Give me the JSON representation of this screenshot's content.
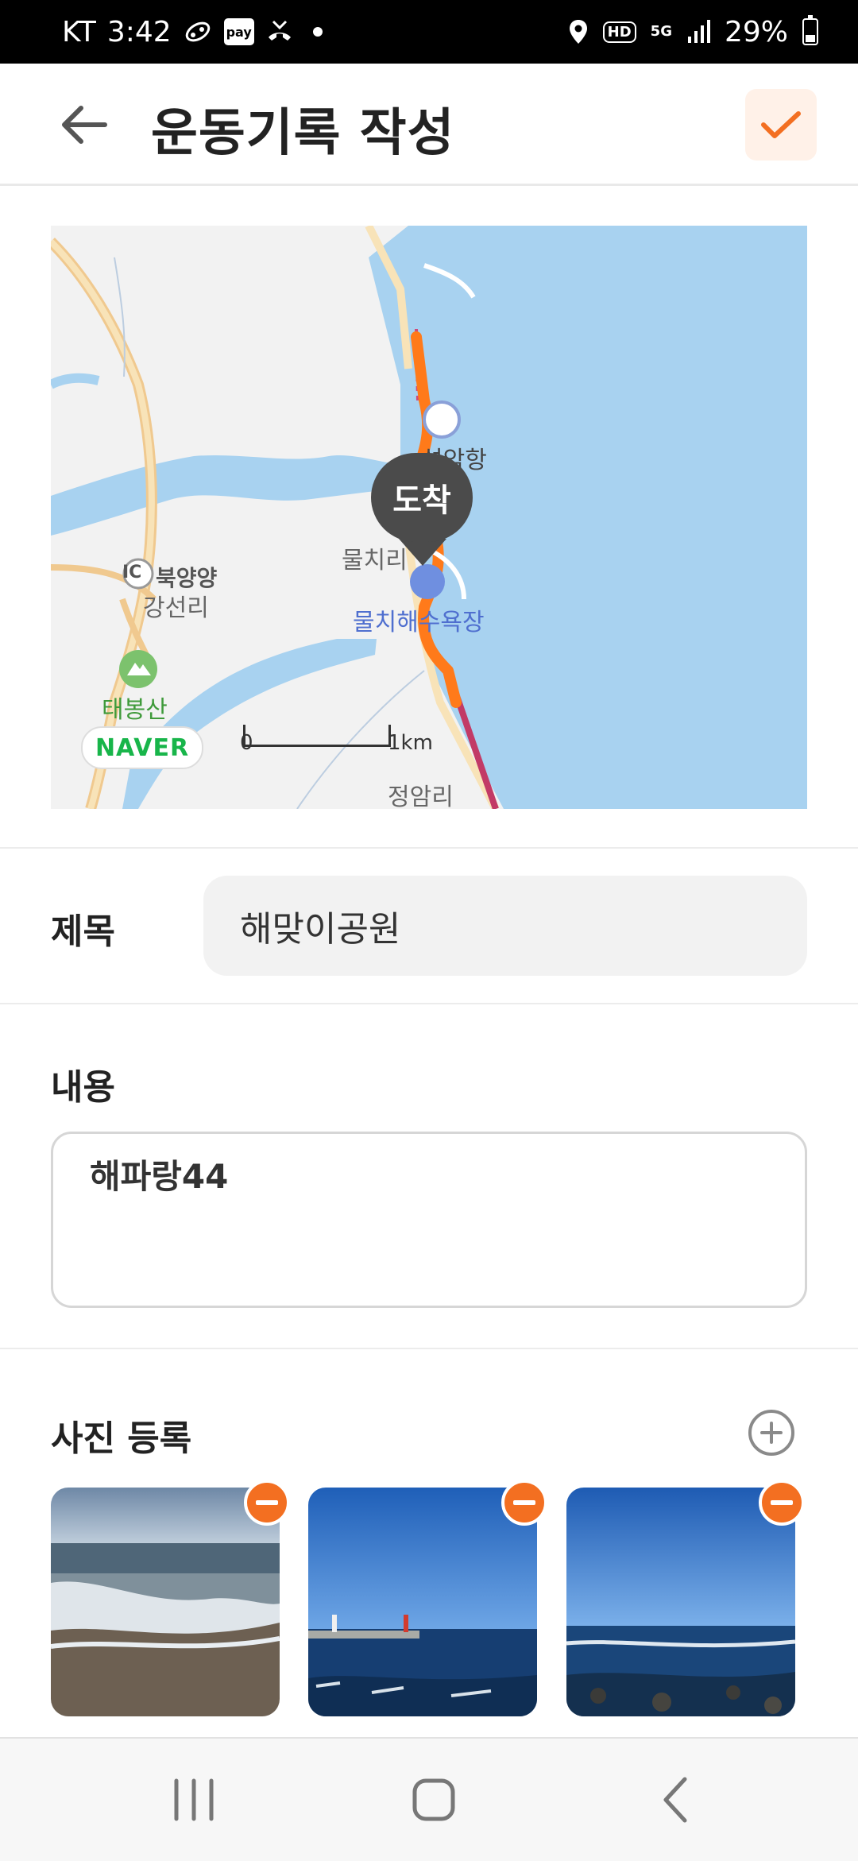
{
  "status_bar": {
    "carrier": "KT",
    "time": "3:42",
    "battery": "29%",
    "hd": "HD",
    "network": "5G",
    "icons": [
      "running-icon",
      "pay-icon",
      "missed-call-icon",
      "notification-dot",
      "location-icon",
      "hd-icon",
      "5g-icon",
      "signal-icon",
      "battery-icon"
    ]
  },
  "header": {
    "title": "운동기록 작성",
    "back_icon": "arrow-left-icon",
    "confirm_icon": "check-icon"
  },
  "map": {
    "pin_label": "도착",
    "labels": [
      "설악항",
      "물치리",
      "북양양",
      "강선리",
      "물치해수욕장",
      "태봉산",
      "정암리"
    ],
    "ic_label": "IC",
    "logo": "NAVER",
    "scale_start": "0",
    "scale_end": "1km"
  },
  "form": {
    "title_label": "제목",
    "title_value": "해맞이공원",
    "content_label": "내용",
    "content_value": "해파랑44",
    "photos_label": "사진 등록",
    "photos": [
      {
        "name": "photo-beach-waves"
      },
      {
        "name": "photo-harbor-lighthouse"
      },
      {
        "name": "photo-sea-rocks"
      }
    ]
  },
  "colors": {
    "accent": "#f36f21",
    "accent_bg": "#fff1e8",
    "sea": "#a8d2f0",
    "route": "#ff7a1a"
  },
  "nav_bar": {
    "icons": [
      "recent-apps-icon",
      "home-icon",
      "back-icon"
    ]
  }
}
